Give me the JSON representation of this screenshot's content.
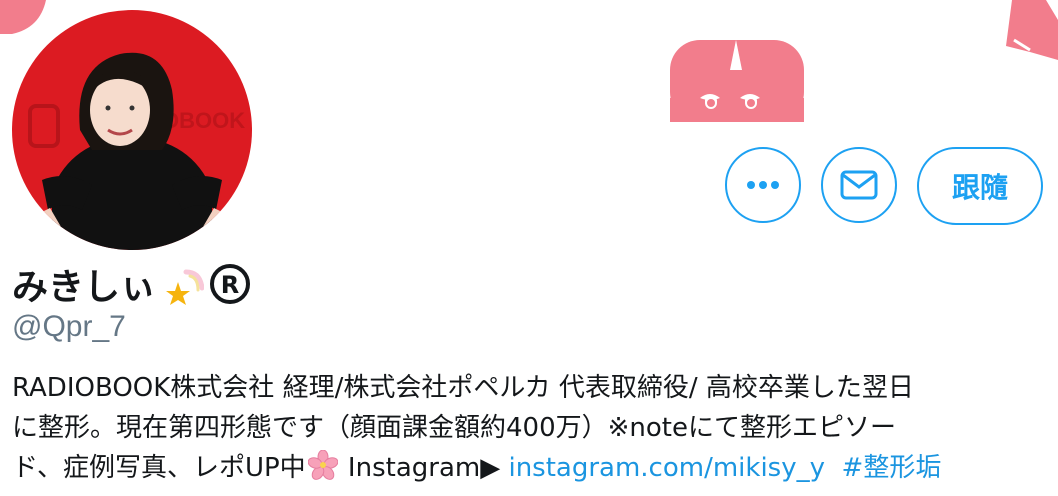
{
  "profile": {
    "display_name": "みきしぃ",
    "name_icons": [
      "shooting-star-emoji",
      "registered-symbol"
    ],
    "handle": "@Qpr_7"
  },
  "actions": {
    "more_icon": "more-dots-icon",
    "message_icon": "envelope-icon",
    "follow_label": "跟隨"
  },
  "bio": {
    "line1": "RADIOBOOK株式会社 経理/株式会社ポペルカ 代表取締役/ 高校卒業した翌日",
    "line2": "に整形。現在第四形態です（顔面課金額約400万）※noteにて整形エピソー",
    "line3_prefix": "ド、症例写真、レポUP中",
    "line3_icon": "cherry-blossom-emoji",
    "line3_instagram": " Instagram▶ ",
    "link_url": "instagram.com/mikisy_y",
    "hashtag": "#整形垢"
  },
  "avatar": {
    "name": "profile-photo",
    "backdrop_text": "OBOOK"
  },
  "colors": {
    "accent": "#1da1f2",
    "link": "#1b95e0",
    "banner_pink": "#f27d8c",
    "text": "#14171a",
    "muted": "#657786"
  }
}
